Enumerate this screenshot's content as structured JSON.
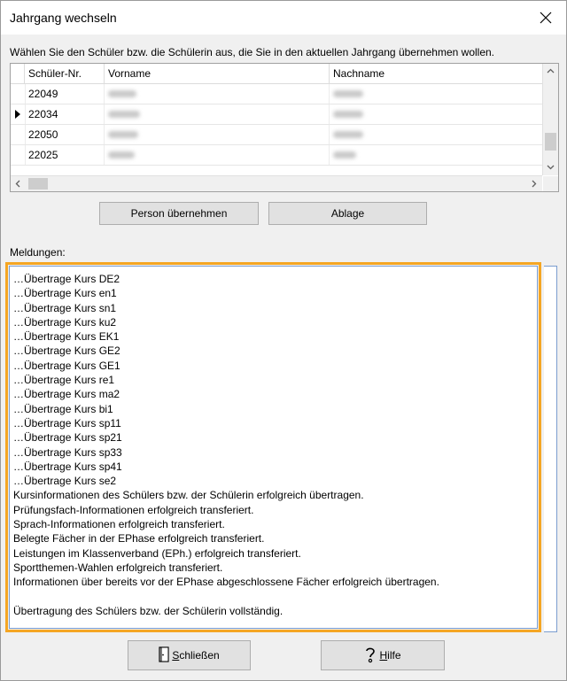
{
  "window": {
    "title": "Jahrgang wechseln"
  },
  "instruction": "Wählen Sie den Schüler bzw. die Schülerin aus, die Sie in den aktuellen Jahrgang übernehmen wollen.",
  "grid": {
    "columns": [
      "Schüler-Nr.",
      "Vorname",
      "Nachname"
    ],
    "rows": [
      {
        "nr": "22049",
        "selected": false
      },
      {
        "nr": "22034",
        "selected": true
      },
      {
        "nr": "22050",
        "selected": false
      },
      {
        "nr": "22025",
        "selected": false
      }
    ]
  },
  "buttons": {
    "person_uebernehmen": "Person übernehmen",
    "ablage": "Ablage",
    "schliessen_first": "S",
    "schliessen_rest": "chließen",
    "hilfe_first": "H",
    "hilfe_rest": "ilfe"
  },
  "messages": {
    "label": "Meldungen:",
    "lines": [
      "…Übertrage Kurs DE2",
      "…Übertrage Kurs en1",
      "…Übertrage Kurs sn1",
      "…Übertrage Kurs ku2",
      "…Übertrage Kurs EK1",
      "…Übertrage Kurs GE2",
      "…Übertrage Kurs GE1",
      "…Übertrage Kurs re1",
      "…Übertrage Kurs ma2",
      "…Übertrage Kurs bi1",
      "…Übertrage Kurs sp11",
      "…Übertrage Kurs sp21",
      "…Übertrage Kurs sp33",
      "…Übertrage Kurs sp41",
      "…Übertrage Kurs se2",
      "Kursinformationen des Schülers bzw. der Schülerin erfolgreich übertragen.",
      "Prüfungsfach-Informationen erfolgreich transferiert.",
      "Sprach-Informationen erfolgreich transferiert.",
      "Belegte Fächer in der EPhase erfolgreich transferiert.",
      "Leistungen im Klassenverband (EPh.) erfolgreich transferiert.",
      "Sportthemen-Wahlen erfolgreich transferiert.",
      "Informationen über bereits vor der EPhase abgeschlossene Fächer erfolgreich übertragen.",
      "",
      "Übertragung des Schülers bzw. der Schülerin vollständig."
    ]
  },
  "colors": {
    "highlight_border": "#f5a623",
    "field_border": "#7a9ccf"
  }
}
